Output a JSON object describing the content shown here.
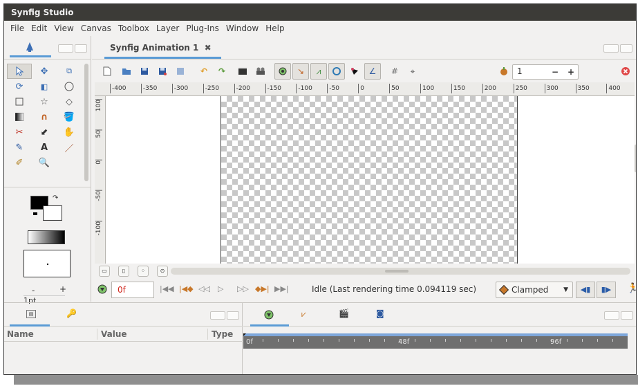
{
  "app": {
    "title": "Synfig Studio"
  },
  "menu": [
    "File",
    "Edit",
    "View",
    "Canvas",
    "Toolbox",
    "Layer",
    "Plug-Ins",
    "Window",
    "Help"
  ],
  "document": {
    "tab_title": "Synfig Animation 1",
    "close_glyph": "✖"
  },
  "toolbar": {
    "frame_value": "1",
    "minus": "−",
    "plus": "+"
  },
  "ruler_h": [
    "-400",
    "-350",
    "-300",
    "-250",
    "-200",
    "-150",
    "-100",
    "-50",
    "0",
    "50",
    "100",
    "150",
    "200",
    "250",
    "300",
    "350",
    "400"
  ],
  "ruler_v": [
    "100",
    "50",
    "0",
    "-50",
    "-100"
  ],
  "toolbox": {
    "brush_size": "1pt",
    "minus": "-",
    "plus": "+"
  },
  "timebar": {
    "current_time": "0f",
    "status": "Idle (Last rendering time 0.094119 sec)",
    "interpolation": "Clamped"
  },
  "params": {
    "columns": [
      "Name",
      "Value",
      "Type"
    ]
  },
  "timetrack": {
    "labels": [
      "0f",
      "48f",
      "96f"
    ]
  },
  "colors": {
    "accent": "#5a9bd5",
    "titlebar": "#3c3b37",
    "time_text": "#d0261c",
    "interp_diamond": "#c8782a"
  }
}
